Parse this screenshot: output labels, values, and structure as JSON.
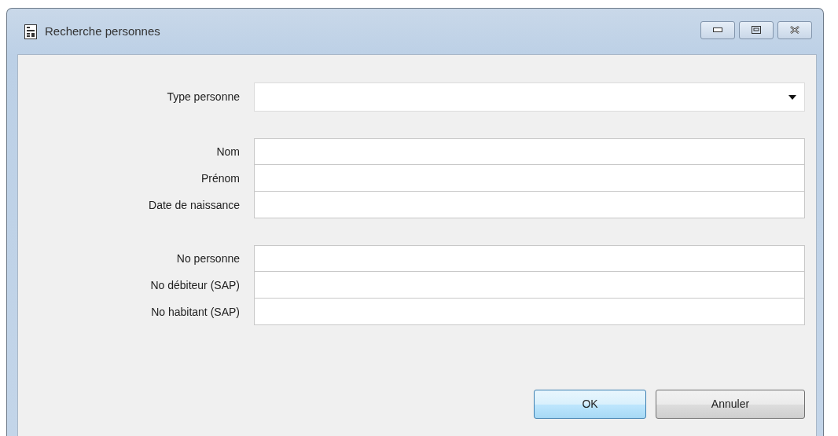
{
  "window": {
    "title": "Recherche personnes"
  },
  "groups": [
    {
      "fields": [
        {
          "label": "Type personne",
          "kind": "dropdown"
        }
      ]
    },
    {
      "fields": [
        {
          "label": "Nom",
          "kind": "text"
        },
        {
          "label": "Prénom",
          "kind": "text"
        },
        {
          "label": "Date de naissance",
          "kind": "text"
        }
      ]
    },
    {
      "fields": [
        {
          "label": "No personne",
          "kind": "text"
        },
        {
          "label": "No débiteur (SAP)",
          "kind": "text"
        },
        {
          "label": "No habitant (SAP)",
          "kind": "text"
        }
      ]
    }
  ],
  "buttons": [
    {
      "label": "OK",
      "default": true
    },
    {
      "label": "Annuler",
      "default": false
    }
  ]
}
